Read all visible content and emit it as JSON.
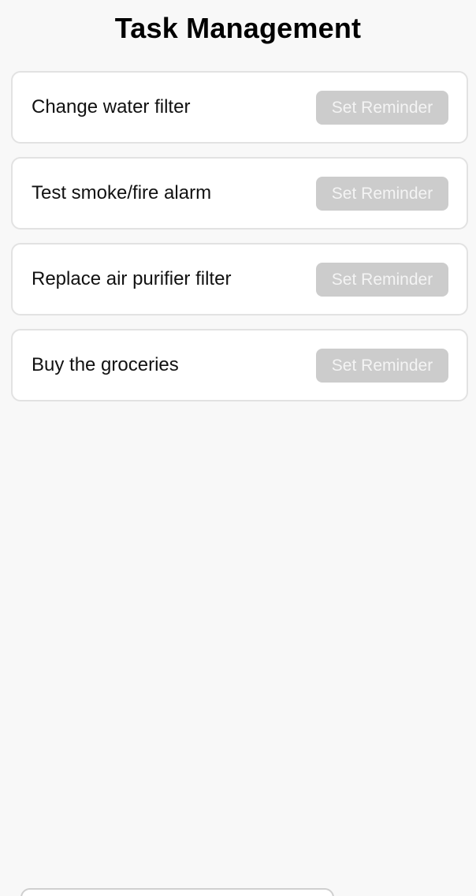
{
  "header": {
    "title": "Task Management"
  },
  "tasks": [
    {
      "label": "Change water filter",
      "button_label": "Set Reminder"
    },
    {
      "label": "Test smoke/fire alarm",
      "button_label": "Set Reminder"
    },
    {
      "label": "Replace air purifier filter",
      "button_label": "Set Reminder"
    },
    {
      "label": "Buy the groceries",
      "button_label": "Set Reminder"
    }
  ],
  "colors": {
    "background": "#f8f8f8",
    "card": "#ffffff",
    "button_disabled": "#cccccc"
  }
}
